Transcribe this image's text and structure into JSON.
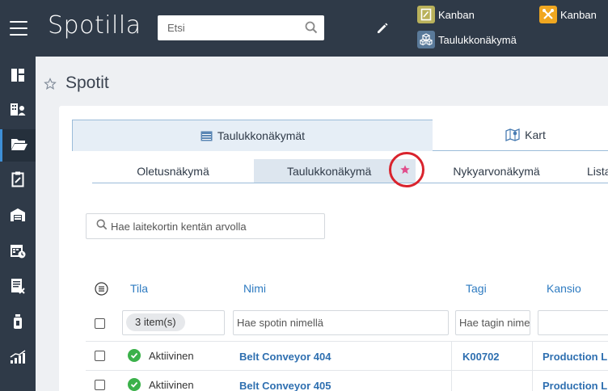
{
  "app": {
    "name": "Spotilla"
  },
  "header": {
    "search_placeholder": "Etsi",
    "quick_links": [
      {
        "label": "Kanban",
        "icon": "kanban-doc-icon",
        "color": "#b9b15b"
      },
      {
        "label": "Taulukkonäkymä",
        "icon": "boxes-icon",
        "color": "#5a7a9a"
      },
      {
        "label": "Kanban",
        "icon": "tools-icon",
        "color": "#f0a720"
      }
    ]
  },
  "sidebar": {
    "items": [
      {
        "icon": "dashboard-icon"
      },
      {
        "icon": "organization-icon"
      },
      {
        "icon": "folder-icon",
        "active": true
      },
      {
        "icon": "checklist-icon"
      },
      {
        "icon": "warehouse-icon"
      },
      {
        "icon": "calendar-icon"
      },
      {
        "icon": "report-icon"
      },
      {
        "icon": "sensor-icon"
      },
      {
        "icon": "analytics-icon"
      }
    ]
  },
  "page": {
    "title": "Spotit"
  },
  "main_tabs": [
    {
      "label": "Taulukkonäkymät",
      "icon": "table-icon",
      "active": true
    },
    {
      "label": "Kart",
      "icon": "map-icon"
    }
  ],
  "sub_tabs": [
    {
      "label": "Oletusnäkymä"
    },
    {
      "label": "Taulukkonäkymä",
      "active": true
    },
    {
      "label": "Nykyarvonäkymä"
    },
    {
      "label": "Lista"
    }
  ],
  "filter": {
    "placeholder": "Hae laitekortin kentän arvolla"
  },
  "table": {
    "columns": [
      "Tila",
      "Nimi",
      "Tagi",
      "Kansio"
    ],
    "filters": {
      "status_chip": "3 item(s)",
      "name_placeholder": "Hae spotin nimellä",
      "tag_placeholder": "Hae tagin nimellä"
    },
    "rows": [
      {
        "status": "Aktiivinen",
        "name": "Belt Conveyor 404",
        "tag": "K00702",
        "folder": "Production Li"
      },
      {
        "status": "Aktiivinen",
        "name": "Belt Conveyor 405",
        "tag": "",
        "folder": "Production Li"
      }
    ]
  },
  "colors": {
    "topbar": "#2f3a48",
    "link": "#2e6fb0",
    "status_active": "#3bb14a",
    "highlight": "#d9232d"
  }
}
